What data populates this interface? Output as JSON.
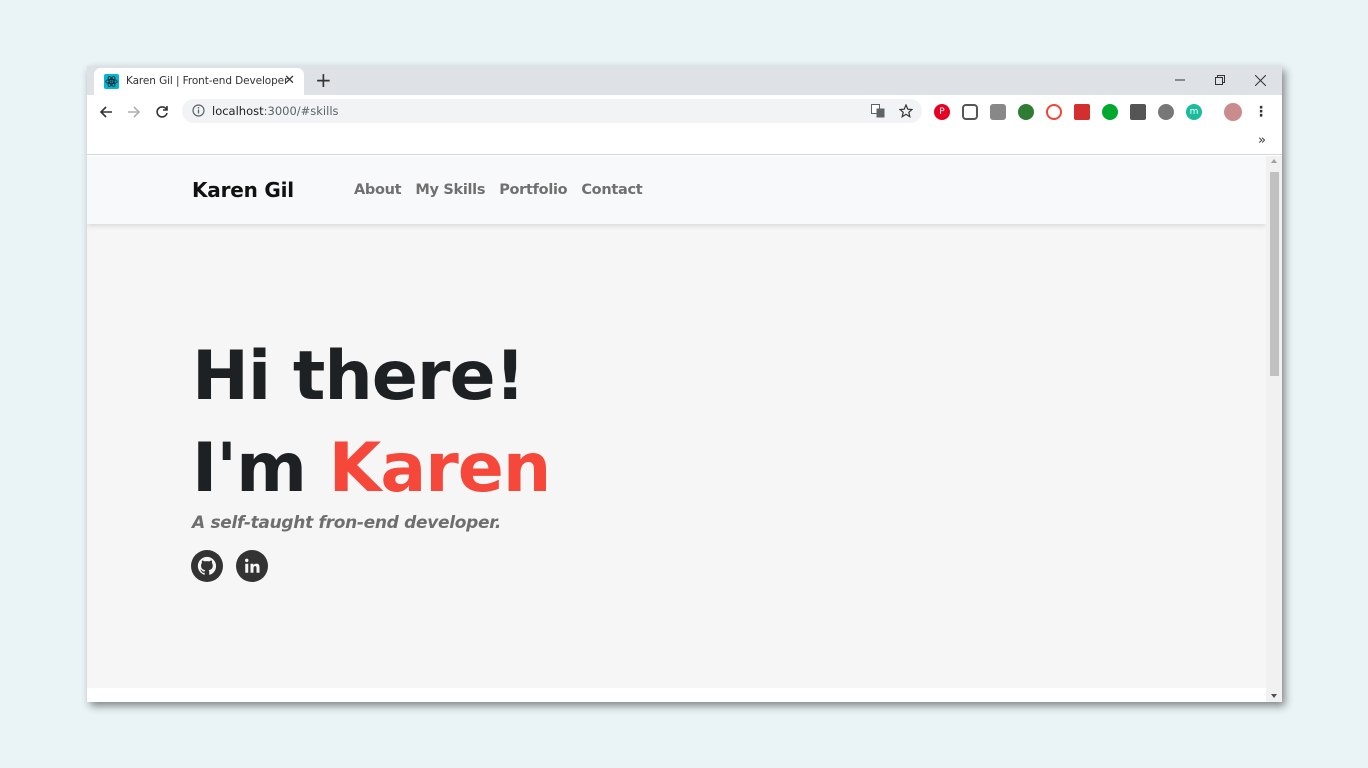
{
  "browser": {
    "tab": {
      "title": "Karen Gil | Front-end Developer"
    },
    "address": {
      "host": "localhost",
      "path": ":3000/#skills"
    },
    "bookmarks_more": "»"
  },
  "site": {
    "brand": "Karen Gil",
    "nav": [
      "About",
      "My Skills",
      "Portfolio",
      "Contact"
    ],
    "hero": {
      "line1": "Hi there!",
      "line2_prefix": "I'm ",
      "line2_name": "Karen",
      "tagline": "A self-taught fron-end developer."
    },
    "social": [
      "github-icon",
      "linkedin-icon"
    ]
  },
  "colors": {
    "accent": "#f6473b",
    "heading": "#1d2124",
    "navlink": "#707070"
  }
}
